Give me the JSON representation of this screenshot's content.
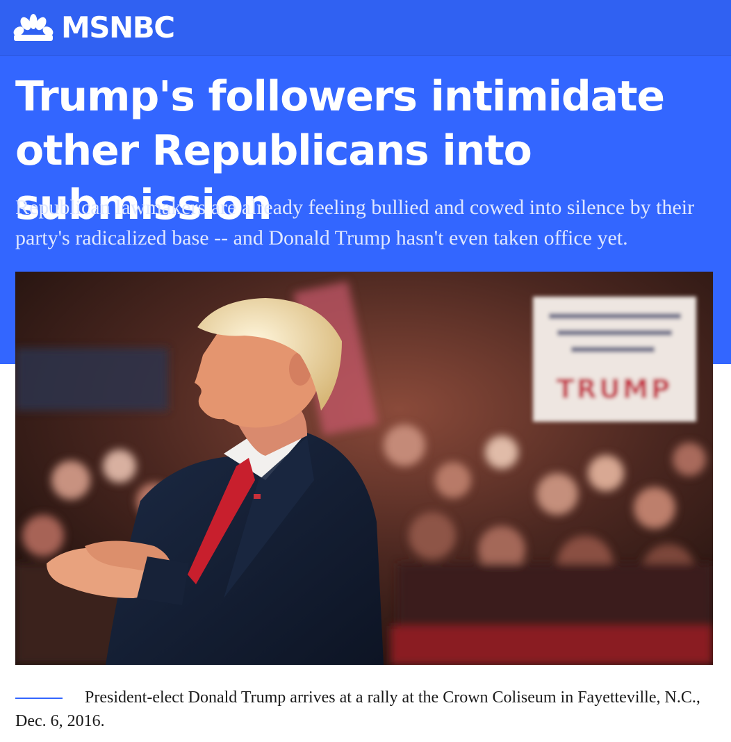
{
  "header": {
    "brand": "MSNBC",
    "logo_icon": "peacock-icon",
    "bg_color": "#3061f2"
  },
  "article": {
    "headline": "Trump's followers intimidate other Republicans into submission",
    "dek": "Republican lawmakers are already feeling bullied and cowed into silence by their party's radicalized base -- and Donald Trump hasn't even taken office yet.",
    "hero_color": "#3366ff",
    "photo": {
      "sign_text": "TRUMP"
    },
    "caption": "President-elect Donald Trump arrives at a rally at the Crown Coliseum in Fayetteville, N.C., Dec. 6, 2016."
  }
}
